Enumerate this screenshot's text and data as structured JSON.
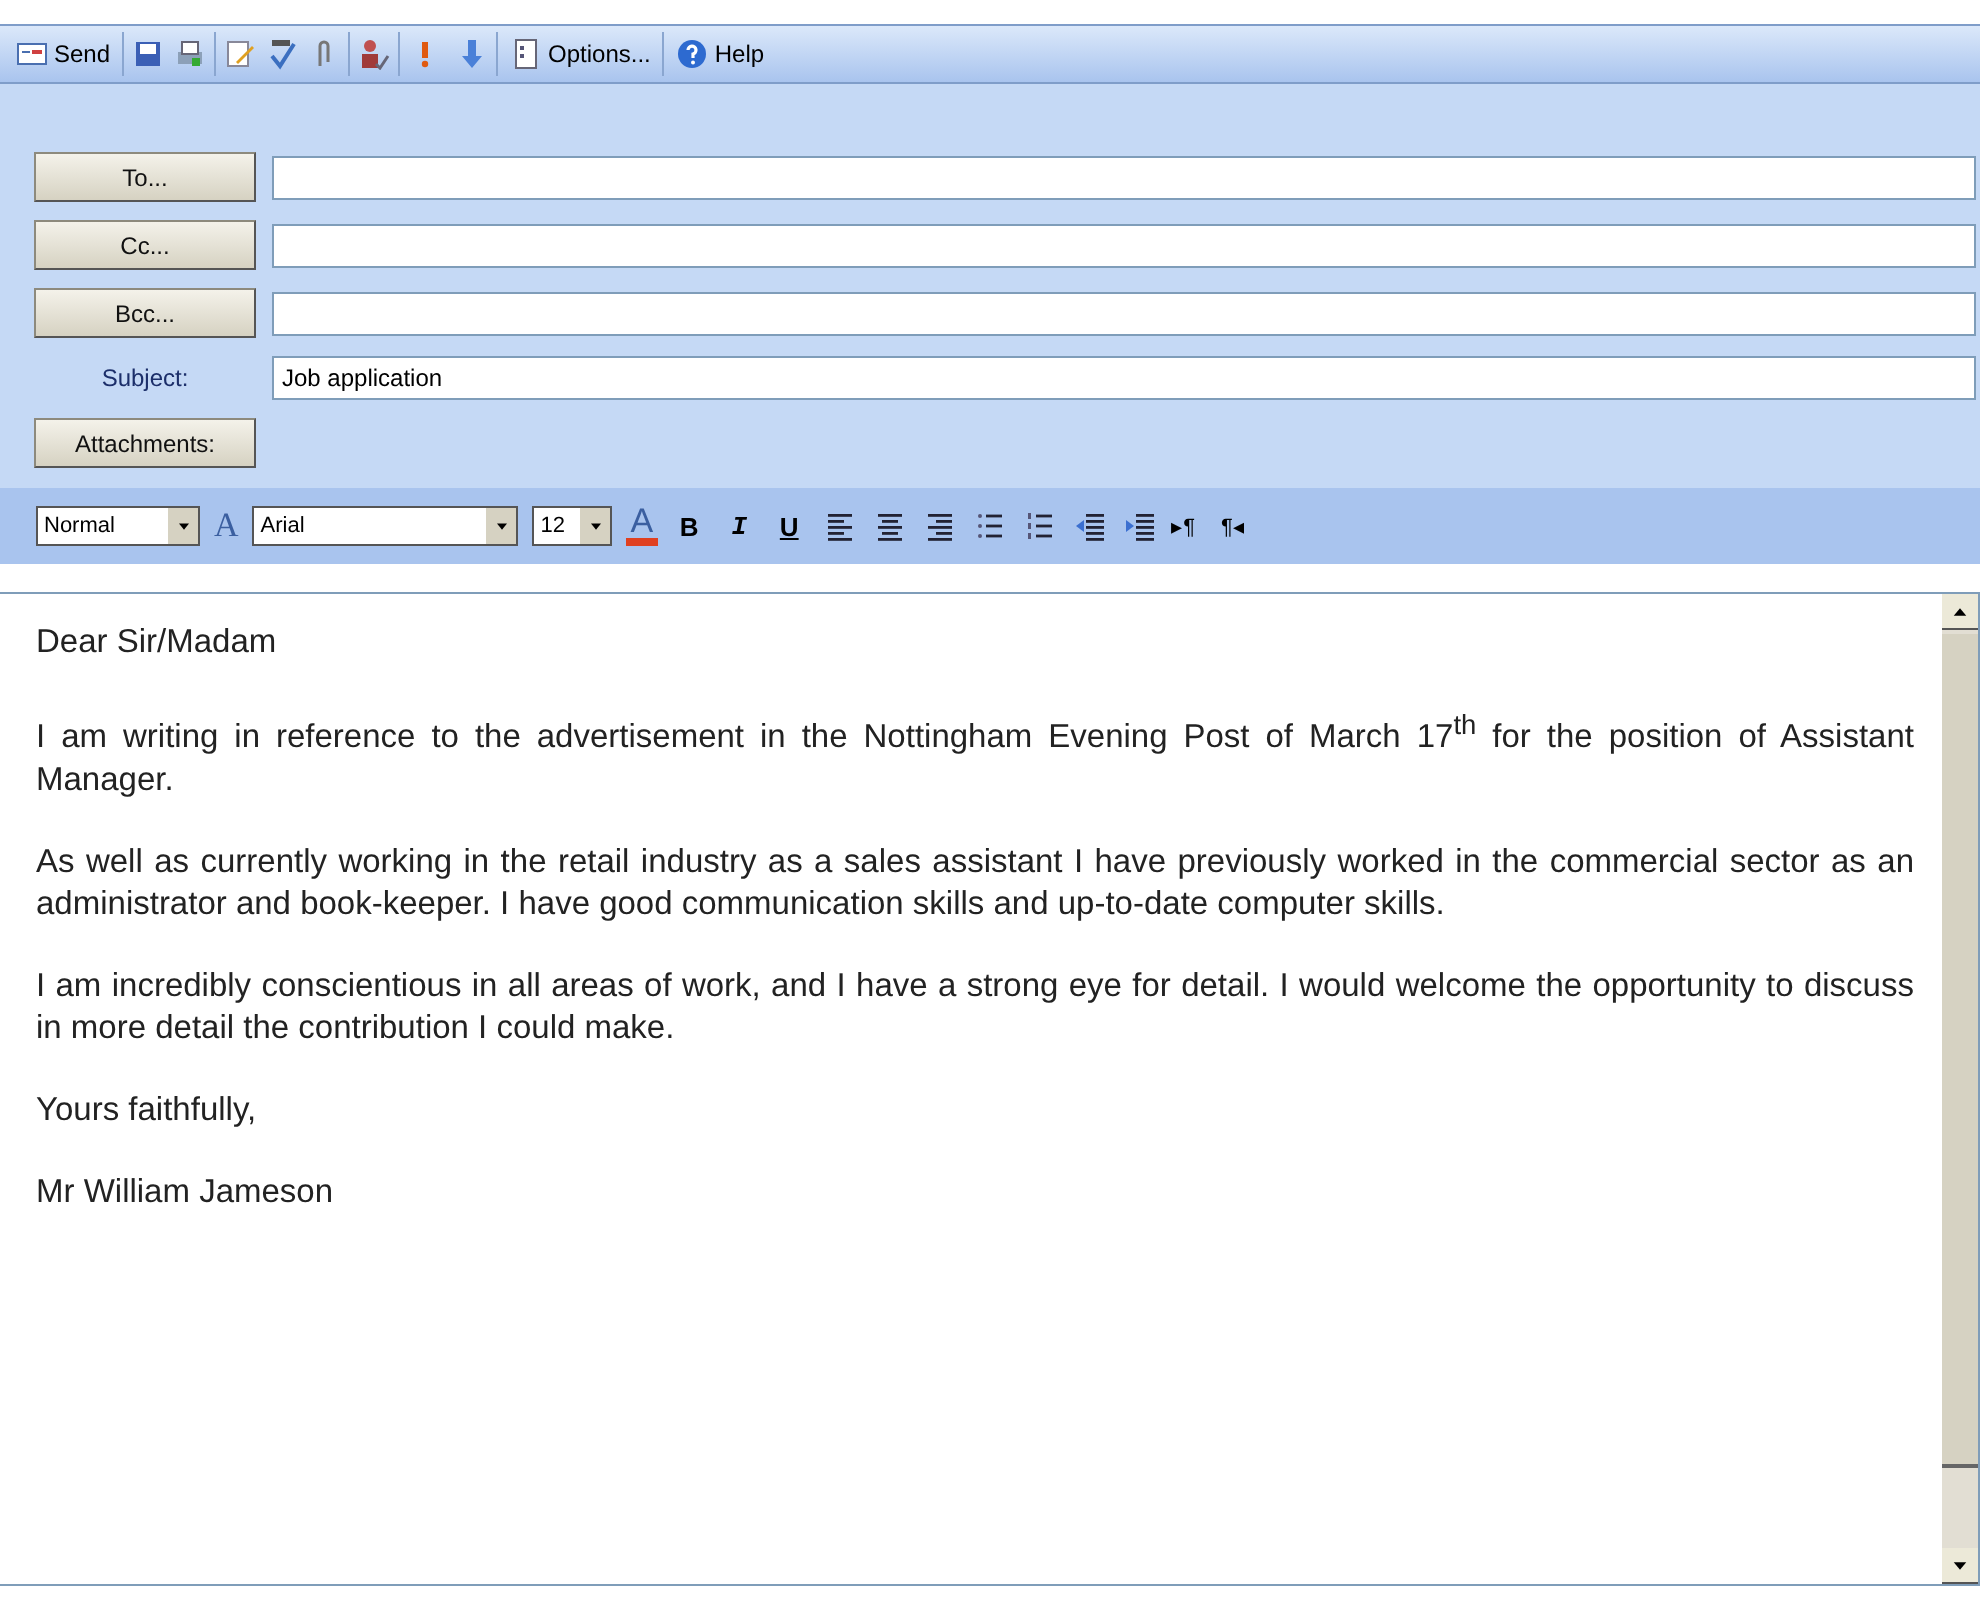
{
  "toolbar": {
    "send": "Send",
    "options": "Options...",
    "help": "Help"
  },
  "address": [
    {
      "kind": "button",
      "label": "To..."
    },
    {
      "kind": "button",
      "label": "Cc..."
    },
    {
      "kind": "button",
      "label": "Bcc..."
    },
    {
      "kind": "label",
      "label": "Subject:",
      "value": "Job application"
    }
  ],
  "attachments": "Attachments:",
  "format": {
    "style": "Normal",
    "font_icon": "A",
    "font": "Arial",
    "size": "12",
    "font_color": "A",
    "bold": "B",
    "italic": "I",
    "underline": "U",
    "ltr": "▸¶",
    "rtl": "¶◂"
  },
  "body": [
    "Dear Sir/Madam",
    "I am writing in reference to the advertisement in the Nottingham Evening Post of March 17$^{th}$ for the position of Assistant Manager.",
    "As well as currently working in the retail industry as a sales assistant I have previously worked in the commercial sector as an administrator and book-keeper. I have good communication skills and up-to-date computer skills.",
    "I am incredibly conscientious in all areas of work, and I have a strong eye for detail. I would welcome the opportunity to discuss in more detail the contribution I could make.",
    "Yours faithfully,",
    "Mr William Jameson"
  ]
}
